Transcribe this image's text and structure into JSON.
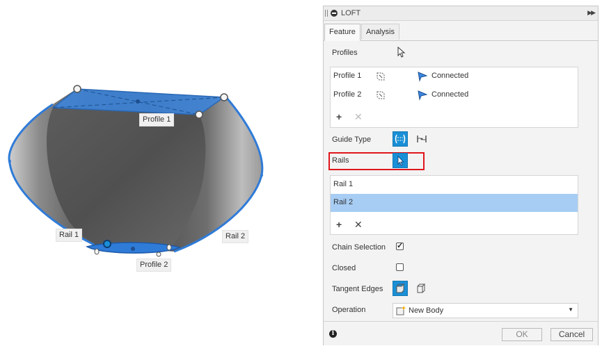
{
  "viewport": {
    "labels": {
      "profile1": "Profile 1",
      "profile2": "Profile 2",
      "rail1": "Rail 1",
      "rail2": "Rail 2"
    }
  },
  "panel": {
    "title": "LOFT",
    "tabs": [
      {
        "label": "Feature",
        "active": true
      },
      {
        "label": "Analysis",
        "active": false
      }
    ],
    "profiles": {
      "label": "Profiles",
      "items": [
        {
          "name": "Profile 1",
          "status": "Connected"
        },
        {
          "name": "Profile 2",
          "status": "Connected"
        }
      ]
    },
    "guide_type": {
      "label": "Guide Type"
    },
    "rails": {
      "label": "Rails",
      "items": [
        {
          "name": "Rail 1",
          "selected": false
        },
        {
          "name": "Rail 2",
          "selected": true
        }
      ]
    },
    "chain_selection": {
      "label": "Chain Selection",
      "checked": true
    },
    "closed": {
      "label": "Closed",
      "checked": false
    },
    "tangent_edges": {
      "label": "Tangent Edges"
    },
    "operation": {
      "label": "Operation",
      "value": "New Body"
    },
    "buttons": {
      "ok": "OK",
      "cancel": "Cancel"
    }
  },
  "colors": {
    "accent": "#1a8fd6",
    "selection": "#a7cdf4",
    "highlight": "#e0151b",
    "profile_blue": "#2f7bd8"
  }
}
